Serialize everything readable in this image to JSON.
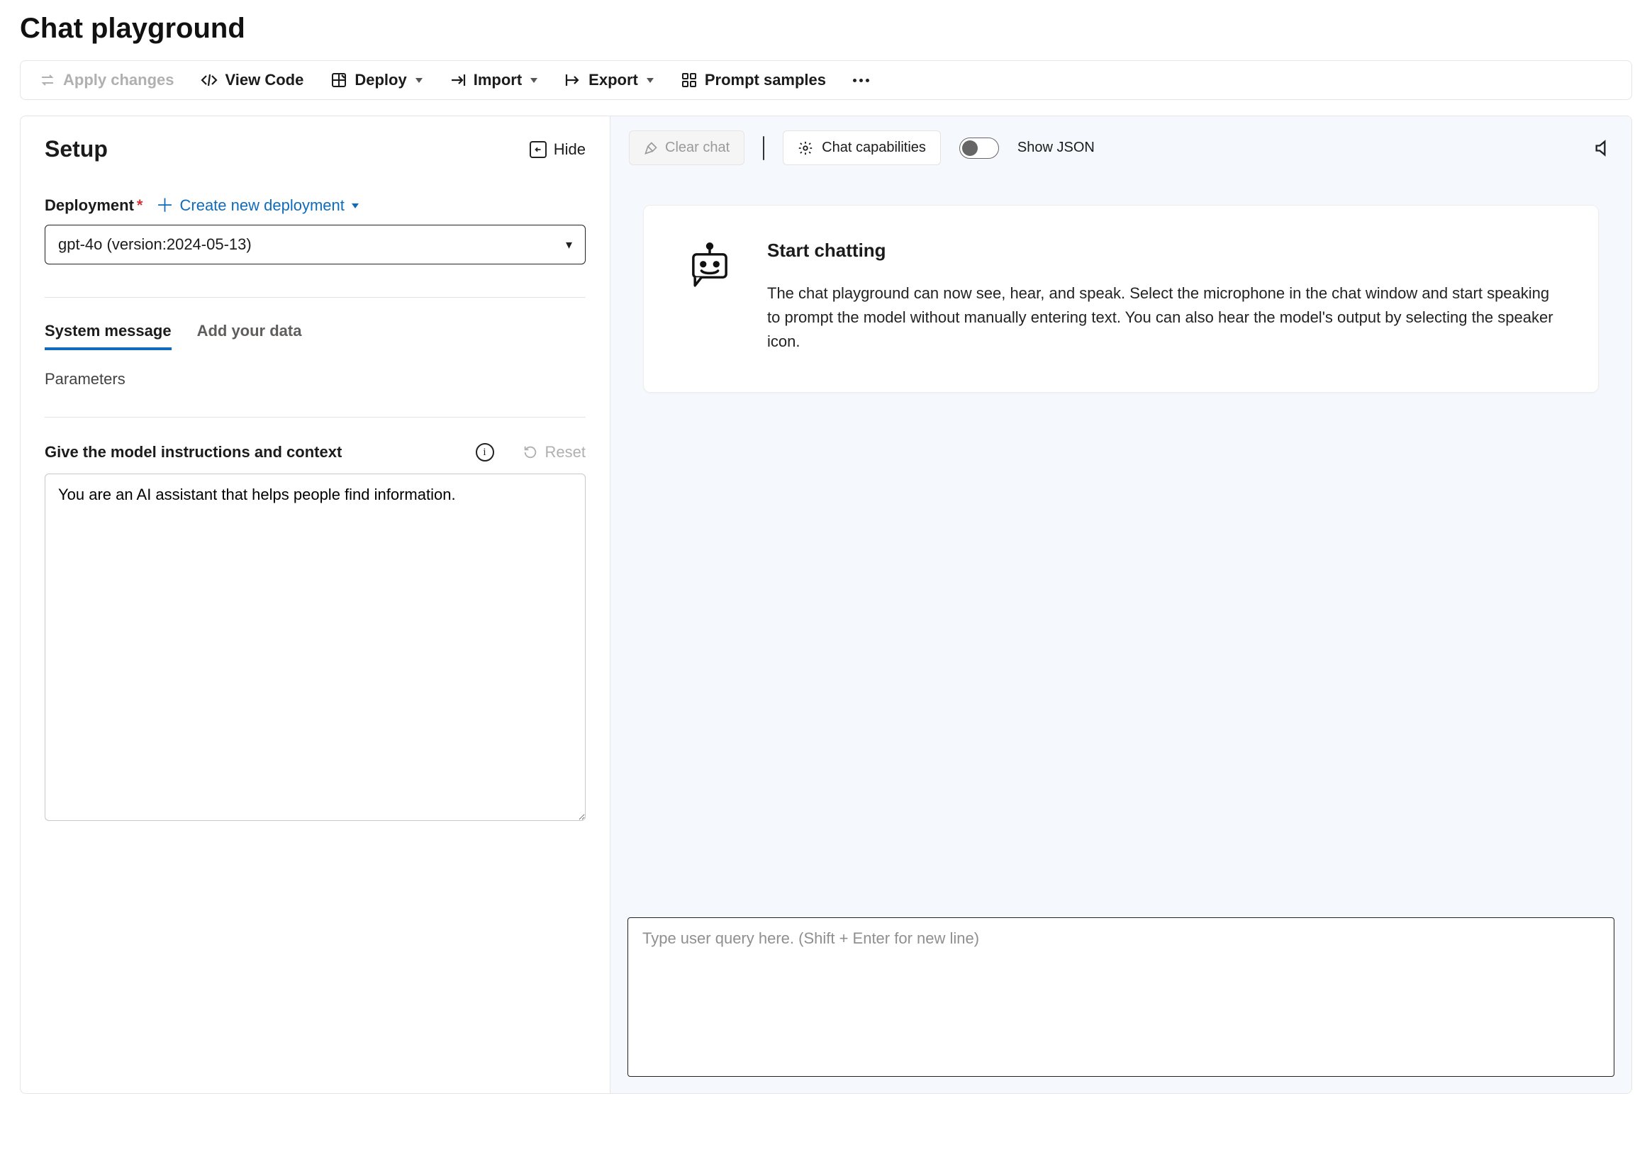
{
  "page": {
    "title": "Chat playground"
  },
  "toolbar": {
    "apply_changes": "Apply changes",
    "view_code": "View Code",
    "deploy": "Deploy",
    "import": "Import",
    "export": "Export",
    "prompt_samples": "Prompt samples"
  },
  "setup": {
    "title": "Setup",
    "hide": "Hide",
    "deployment_label": "Deployment",
    "create_new": "Create new deployment",
    "selected_deployment": "gpt-4o (version:2024-05-13)",
    "tab_system": "System message",
    "tab_data": "Add your data",
    "parameters": "Parameters",
    "instructions_label": "Give the model instructions and context",
    "reset": "Reset",
    "system_message": "You are an AI assistant that helps people find information."
  },
  "chat": {
    "clear": "Clear chat",
    "capabilities": "Chat capabilities",
    "show_json": "Show JSON",
    "start_title": "Start chatting",
    "start_body": "The chat playground can now see, hear, and speak. Select the microphone in the chat window and start speaking to prompt the model without manually entering text. You can also hear the model's output by selecting the speaker icon.",
    "input_placeholder": "Type user query here. (Shift + Enter for new line)"
  }
}
